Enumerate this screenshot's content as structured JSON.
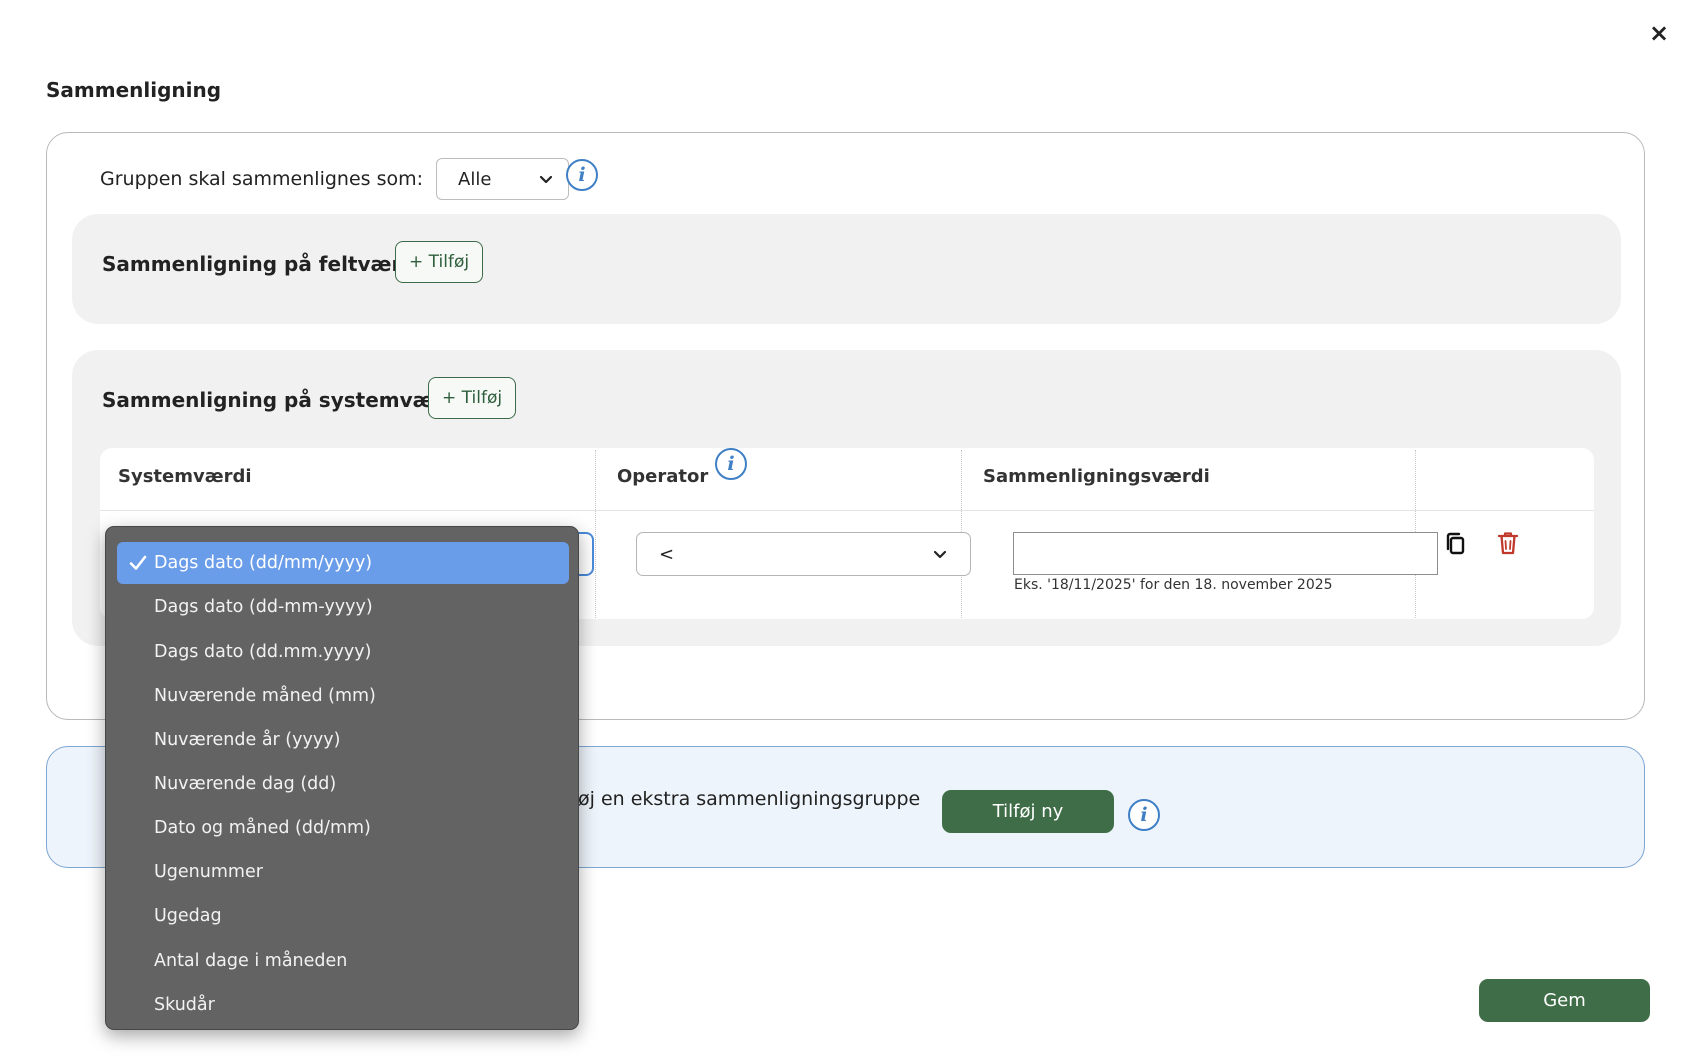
{
  "dialog": {
    "title": "Sammenligning",
    "close_glyph": "×"
  },
  "group": {
    "match_label": "Gruppen skal sammenlignes som:",
    "match_value": "Alle"
  },
  "field_panel": {
    "title": "Sammenligning på feltværdi",
    "add_label": "+ Tilføj"
  },
  "system_panel": {
    "title": "Sammenligning på systemværdi",
    "add_label": "+ Tilføj",
    "columns": [
      "Systemværdi",
      "Operator",
      "Sammenligningsværdi"
    ],
    "row": {
      "operator": "<",
      "compare_value": "",
      "hint": "Eks. '18/11/2025' for den 18. november 2025"
    }
  },
  "extra_group": {
    "text": "øj en ekstra sammenligningsgruppe",
    "button_label": "Tilføj ny"
  },
  "footer": {
    "save_label": "Gem"
  },
  "dropdown": {
    "selected_index": 0,
    "options": [
      "Dags dato (dd/mm/yyyy)",
      "Dags dato (dd-mm-yyyy)",
      "Dags dato (dd.mm.yyyy)",
      "Nuværende måned (mm)",
      "Nuværende år (yyyy)",
      "Nuværende dag (dd)",
      "Dato og måned (dd/mm)",
      "Ugenummer",
      "Ugedag",
      "Antal dage i måneden",
      "Skudår"
    ]
  },
  "colors": {
    "accent_green": "#3f6d47",
    "info_blue": "#3f7fc5",
    "delete_red": "#c0392b",
    "dropdown_bg": "#636363",
    "dropdown_selected": "#6a9de9"
  }
}
